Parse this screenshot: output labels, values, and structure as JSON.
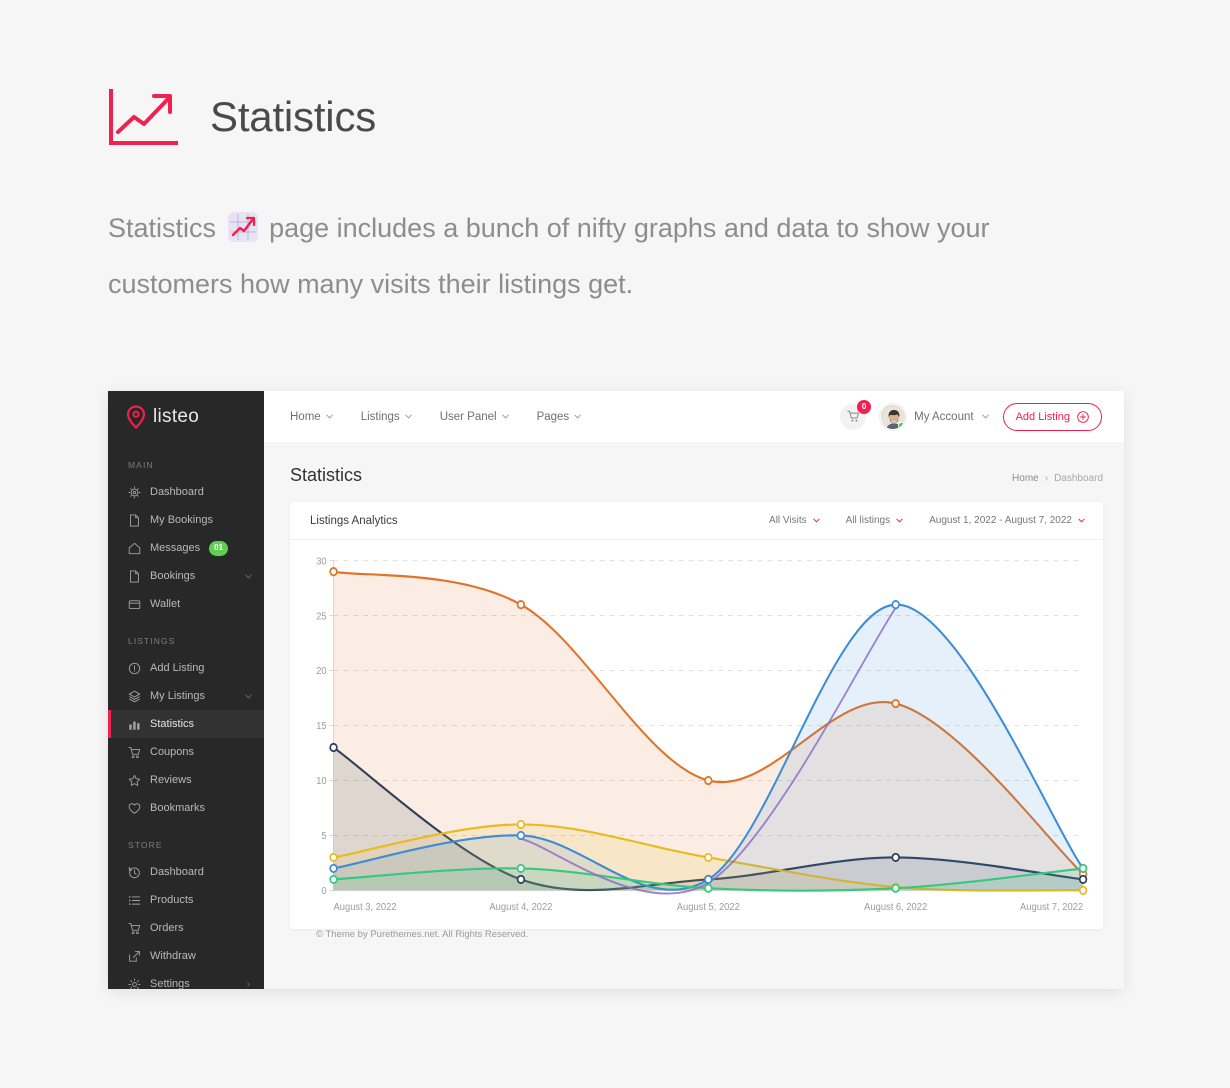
{
  "promo": {
    "icon_name": "chart-growth-icon",
    "title": "Statistics",
    "description_before": "Statistics",
    "description_after": "page includes a bunch of nifty graphs and data to show your customers how many visits their listings get."
  },
  "brand": {
    "name": "listeo",
    "logo_icon": "map-pin-icon"
  },
  "topnav": {
    "items": [
      {
        "label": "Home",
        "caret": true
      },
      {
        "label": "Listings",
        "caret": true
      },
      {
        "label": "User Panel",
        "caret": true
      },
      {
        "label": "Pages",
        "caret": true
      }
    ],
    "cart": {
      "icon": "cart-icon",
      "count": "0"
    },
    "account": {
      "label": "My Account",
      "avatar_icon": "user-avatar",
      "status": "online"
    },
    "add_listing": {
      "label": "Add Listing",
      "icon": "plus-circle-icon"
    }
  },
  "sidebar": {
    "sections": [
      {
        "title": "MAIN",
        "items": [
          {
            "label": "Dashboard",
            "icon": "dashboard-icon",
            "active": false,
            "badge": null,
            "caret": false
          },
          {
            "label": "My Bookings",
            "icon": "bookmark-icon",
            "active": false,
            "badge": null,
            "caret": false
          },
          {
            "label": "Messages",
            "icon": "home-icon",
            "active": false,
            "badge": "01",
            "caret": false
          },
          {
            "label": "Bookings",
            "icon": "bookmark-icon",
            "active": false,
            "badge": null,
            "caret": true
          },
          {
            "label": "Wallet",
            "icon": "wallet-icon",
            "active": false,
            "badge": null,
            "caret": false
          }
        ]
      },
      {
        "title": "LISTINGS",
        "items": [
          {
            "label": "Add Listing",
            "icon": "plus-circle-icon",
            "active": false,
            "badge": null,
            "caret": false
          },
          {
            "label": "My Listings",
            "icon": "layers-icon",
            "active": false,
            "badge": null,
            "caret": true
          },
          {
            "label": "Statistics",
            "icon": "bar-chart-icon",
            "active": true,
            "badge": null,
            "caret": false
          },
          {
            "label": "Coupons",
            "icon": "cart-icon",
            "active": false,
            "badge": null,
            "caret": false
          },
          {
            "label": "Reviews",
            "icon": "star-icon",
            "active": false,
            "badge": null,
            "caret": false
          },
          {
            "label": "Bookmarks",
            "icon": "heart-icon",
            "active": false,
            "badge": null,
            "caret": false
          }
        ]
      },
      {
        "title": "STORE",
        "items": [
          {
            "label": "Dashboard",
            "icon": "clock-icon",
            "active": false,
            "badge": null,
            "caret": false
          },
          {
            "label": "Products",
            "icon": "list-icon",
            "active": false,
            "badge": null,
            "caret": false
          },
          {
            "label": "Orders",
            "icon": "cart-icon",
            "active": false,
            "badge": null,
            "caret": false
          },
          {
            "label": "Withdraw",
            "icon": "external-link-icon",
            "active": false,
            "badge": null,
            "caret": false
          },
          {
            "label": "Settings",
            "icon": "gear-icon",
            "active": false,
            "badge": null,
            "caret": "right"
          }
        ]
      }
    ]
  },
  "page": {
    "title": "Statistics",
    "breadcrumb": {
      "home": "Home",
      "separator": "›",
      "current": "Dashboard"
    }
  },
  "card": {
    "title": "Listings Analytics",
    "filters": [
      {
        "label": "All Visits"
      },
      {
        "label": "All listings"
      },
      {
        "label": "August 1, 2022 - August 7, 2022"
      }
    ]
  },
  "footer": {
    "text": "© Theme by Purethemes.net. All Rights Reserved."
  },
  "colors": {
    "accent": "#f0204f",
    "sidebar_bg": "#282828",
    "page_bg": "#f6f6f6",
    "series_orange": "#e0742a",
    "series_blue": "#3c8dd5",
    "series_dark": "#2f3f57",
    "series_yellow": "#e8bb20",
    "series_green": "#36c97e",
    "series_purple": "#8c6fc4"
  },
  "chart_data": {
    "type": "area",
    "title": "Listings Analytics",
    "xlabel": "",
    "ylabel": "",
    "grid": true,
    "legend": "none",
    "ylim": [
      0,
      30
    ],
    "yticks": [
      0,
      5,
      10,
      15,
      20,
      25,
      30
    ],
    "categories": [
      "August 3, 2022",
      "August 4, 2022",
      "August 5, 2022",
      "August 6, 2022",
      "August 7, 2022"
    ],
    "series": [
      {
        "name": "Orange series",
        "color": "#e0742a",
        "values": [
          29,
          26,
          10,
          17,
          1.5
        ]
      },
      {
        "name": "Blue series",
        "color": "#3c8dd5",
        "values": [
          2,
          5,
          1,
          26,
          2
        ]
      },
      {
        "name": "Dark series",
        "color": "#2f3f57",
        "values": [
          13,
          1,
          1,
          3,
          1
        ]
      },
      {
        "name": "Yellow series",
        "color": "#e8bb20",
        "values": [
          3,
          6,
          3,
          0.3,
          0
        ]
      },
      {
        "name": "Green series",
        "color": "#36c97e",
        "values": [
          1,
          2,
          0.2,
          0.2,
          2
        ]
      }
    ]
  }
}
